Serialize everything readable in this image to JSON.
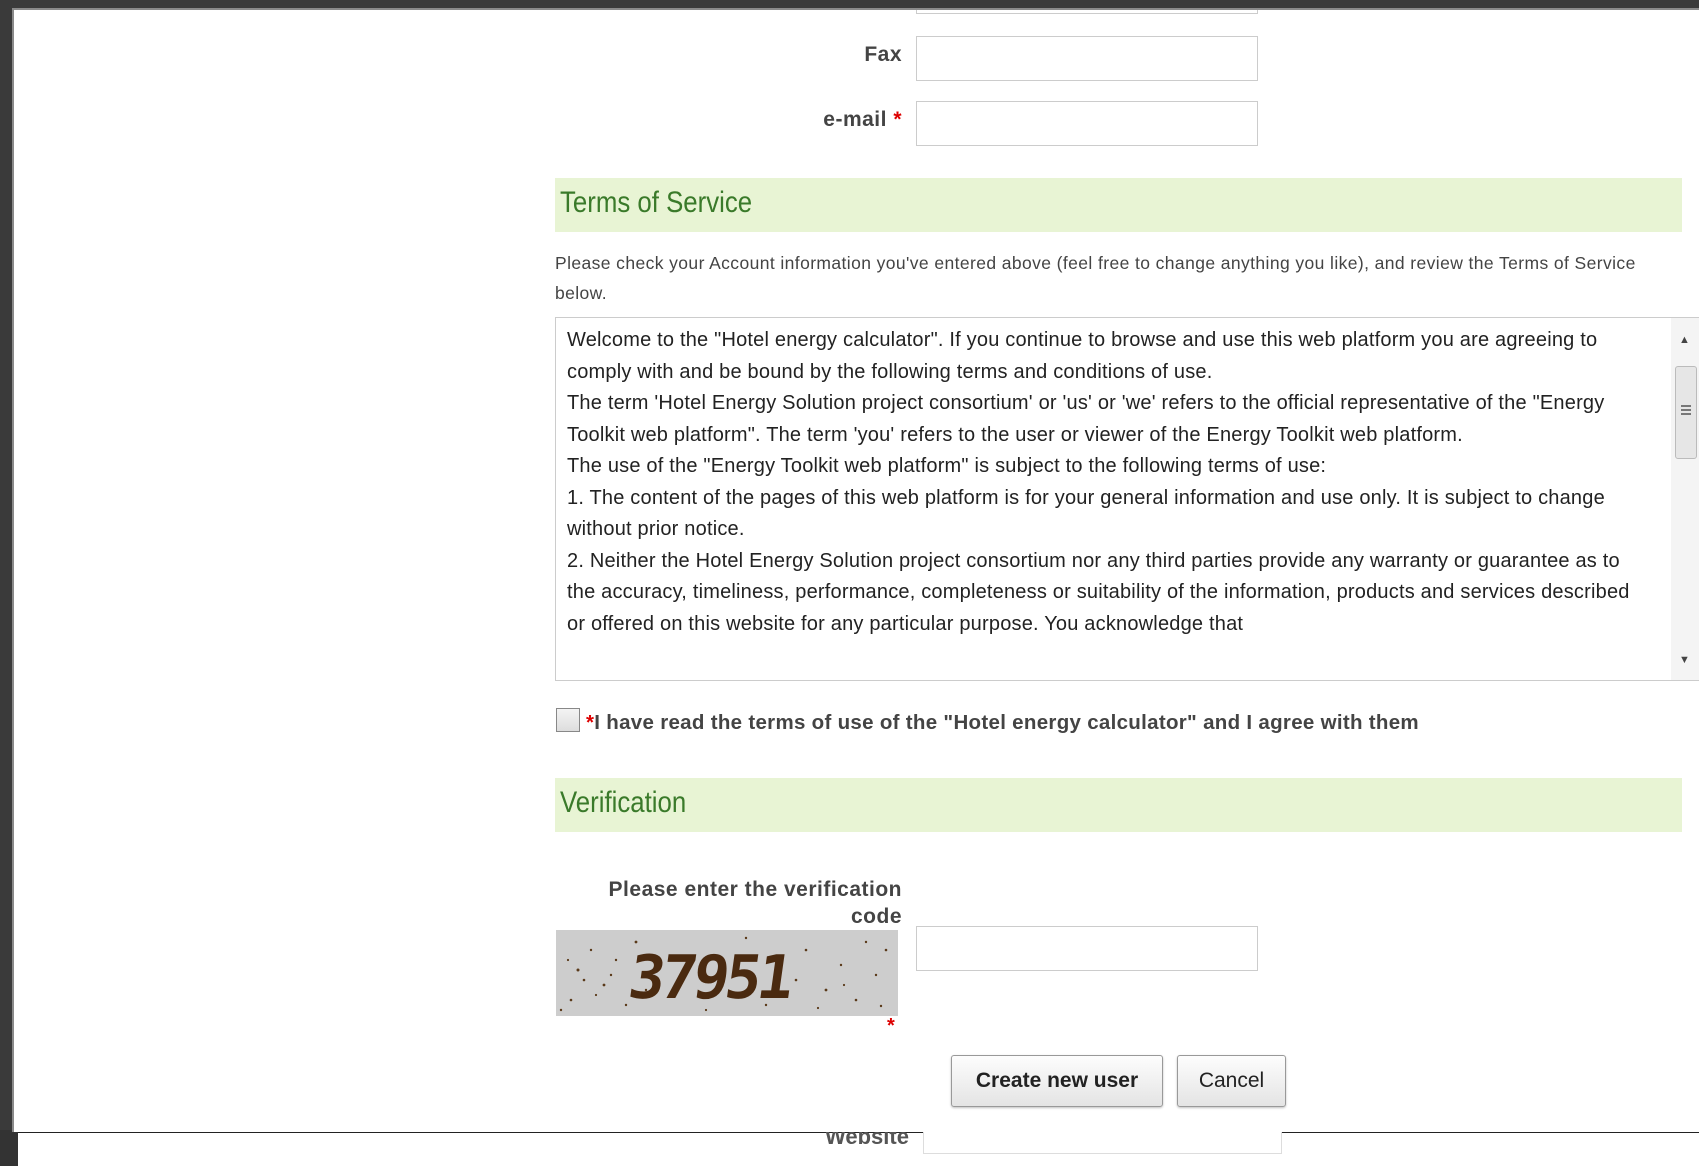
{
  "form": {
    "fax_label": "Fax",
    "email_label": "e-mail",
    "required_mark": "*",
    "fax_value": "",
    "email_value": ""
  },
  "terms": {
    "heading": "Terms of Service",
    "intro": "Please check your Account information you've entered above (feel free to change anything you like), and review the Terms of Service below.",
    "lines": [
      "Welcome to the \"Hotel energy calculator\". If you continue to browse and use this web platform you are agreeing to comply with and be bound by the following terms and conditions of use.",
      "The term 'Hotel Energy Solution project consortium' or 'us' or 'we' refers to the official representative of the \"Energy Toolkit web platform\". The term 'you' refers to the user or viewer of the Energy Toolkit web platform.",
      "The use of the \"Energy Toolkit web platform\" is subject to the following terms of use:",
      "1. The content of the pages of this web platform is for your general information and use only. It is subject to change without prior notice.",
      "2. Neither the Hotel Energy Solution project consortium nor any third parties provide any warranty or guarantee as to the accuracy, timeliness, performance, completeness or suitability of the information, products and services described or offered on this website for any particular purpose. You acknowledge that"
    ],
    "agree_mark": "*",
    "agree_label": "I have read the terms of use of the \"Hotel energy calculator\" and I agree with them",
    "agree_checked": false
  },
  "verification": {
    "heading": "Verification",
    "prompt": "Please enter the verification code",
    "captcha_text": "37951",
    "required_mark": "*",
    "code_value": ""
  },
  "actions": {
    "create_label": "Create new user",
    "cancel_label": "Cancel"
  },
  "background_window": {
    "website_label": "Website"
  },
  "colors": {
    "section_bg": "#e8f4d4",
    "section_text": "#3a7a2a",
    "required": "#dd0000"
  }
}
